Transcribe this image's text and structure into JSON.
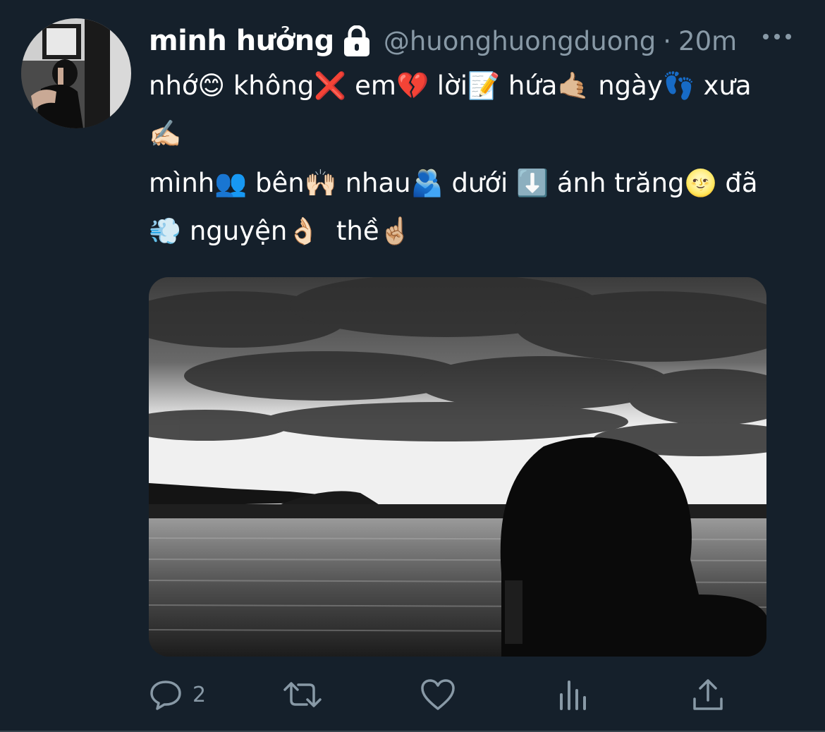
{
  "tweet": {
    "display_name": "minh hưởng",
    "handle": "@huonghuongduong",
    "separator": "·",
    "time": "20m",
    "locked_icon": "lock-icon",
    "more_icon": "more-icon",
    "text_line1": "nhớ😊 không❌ em💔 lời📝 hứa🤙🏼 ngày👣 xưa ✍🏻",
    "text_line2": "mình👥 bên🙌🏻 nhau🫂 dưới ⬇️ ánh trăng🌝 đã 💨 nguyện👌🏻  thề☝🏼"
  },
  "media": {
    "description_icon": "photo",
    "alt": ""
  },
  "actions": {
    "reply": {
      "icon": "reply-icon",
      "count": "2"
    },
    "retweet": {
      "icon": "retweet-icon"
    },
    "like": {
      "icon": "heart-icon"
    },
    "analytics": {
      "icon": "analytics-icon"
    },
    "share": {
      "icon": "share-icon"
    }
  },
  "colors": {
    "background": "#15202b",
    "secondary_text": "#8899a6",
    "divider": "#38444d"
  }
}
